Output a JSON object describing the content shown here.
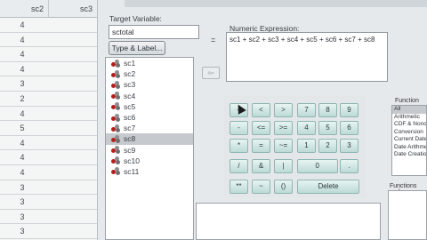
{
  "grid": {
    "headers": [
      "sc2",
      "sc3"
    ],
    "rows": [
      [
        "4",
        ""
      ],
      [
        "4",
        ""
      ],
      [
        "4",
        ""
      ],
      [
        "4",
        ""
      ],
      [
        "3",
        ""
      ],
      [
        "2",
        ""
      ],
      [
        "4",
        ""
      ],
      [
        "5",
        ""
      ],
      [
        "4",
        ""
      ],
      [
        "4",
        ""
      ],
      [
        "4",
        ""
      ],
      [
        "3",
        ""
      ],
      [
        "3",
        ""
      ],
      [
        "3",
        ""
      ],
      [
        "3",
        ""
      ]
    ]
  },
  "dialog": {
    "target_label": "Target Variable:",
    "target_value": "sctotal",
    "type_label_button": "Type & Label...",
    "equals": "=",
    "expr_label": "Numeric Expression:",
    "expression": "sc1 + sc2 + sc3 + sc4 + sc5 + sc6 + sc7 + sc8",
    "arrow": "⇦",
    "variables": [
      "sc1",
      "sc2",
      "sc3",
      "sc4",
      "sc5",
      "sc6",
      "sc7",
      "sc8",
      "sc9",
      "sc10",
      "sc11"
    ],
    "selected_variable": "sc8",
    "keypad": [
      {
        "label": "+"
      },
      {
        "label": "<"
      },
      {
        "label": ">"
      },
      {
        "label": "7"
      },
      {
        "label": "8"
      },
      {
        "label": "9"
      },
      {
        "label": "-"
      },
      {
        "label": "<="
      },
      {
        "label": ">="
      },
      {
        "label": "4"
      },
      {
        "label": "5"
      },
      {
        "label": "6"
      },
      {
        "label": "*"
      },
      {
        "label": "="
      },
      {
        "label": "~="
      },
      {
        "label": "1"
      },
      {
        "label": "2"
      },
      {
        "label": "3"
      },
      {
        "label": "/"
      },
      {
        "label": "&"
      },
      {
        "label": "|"
      },
      {
        "label": "0"
      },
      {
        "label": "."
      },
      {
        "label": "**"
      },
      {
        "label": "~"
      },
      {
        "label": "()"
      },
      {
        "label": "Delete"
      }
    ],
    "function_group_label": "Function group",
    "function_groups": [
      "All",
      "Arithmetic",
      "CDF & Nonc",
      "Conversion",
      "Current Date",
      "Date Arithme",
      "Date Creation"
    ],
    "selected_function_group": "All",
    "functions_label": "Functions and"
  },
  "colors": {
    "keypad": "#c9e6e2",
    "selection": "#c6cace"
  }
}
